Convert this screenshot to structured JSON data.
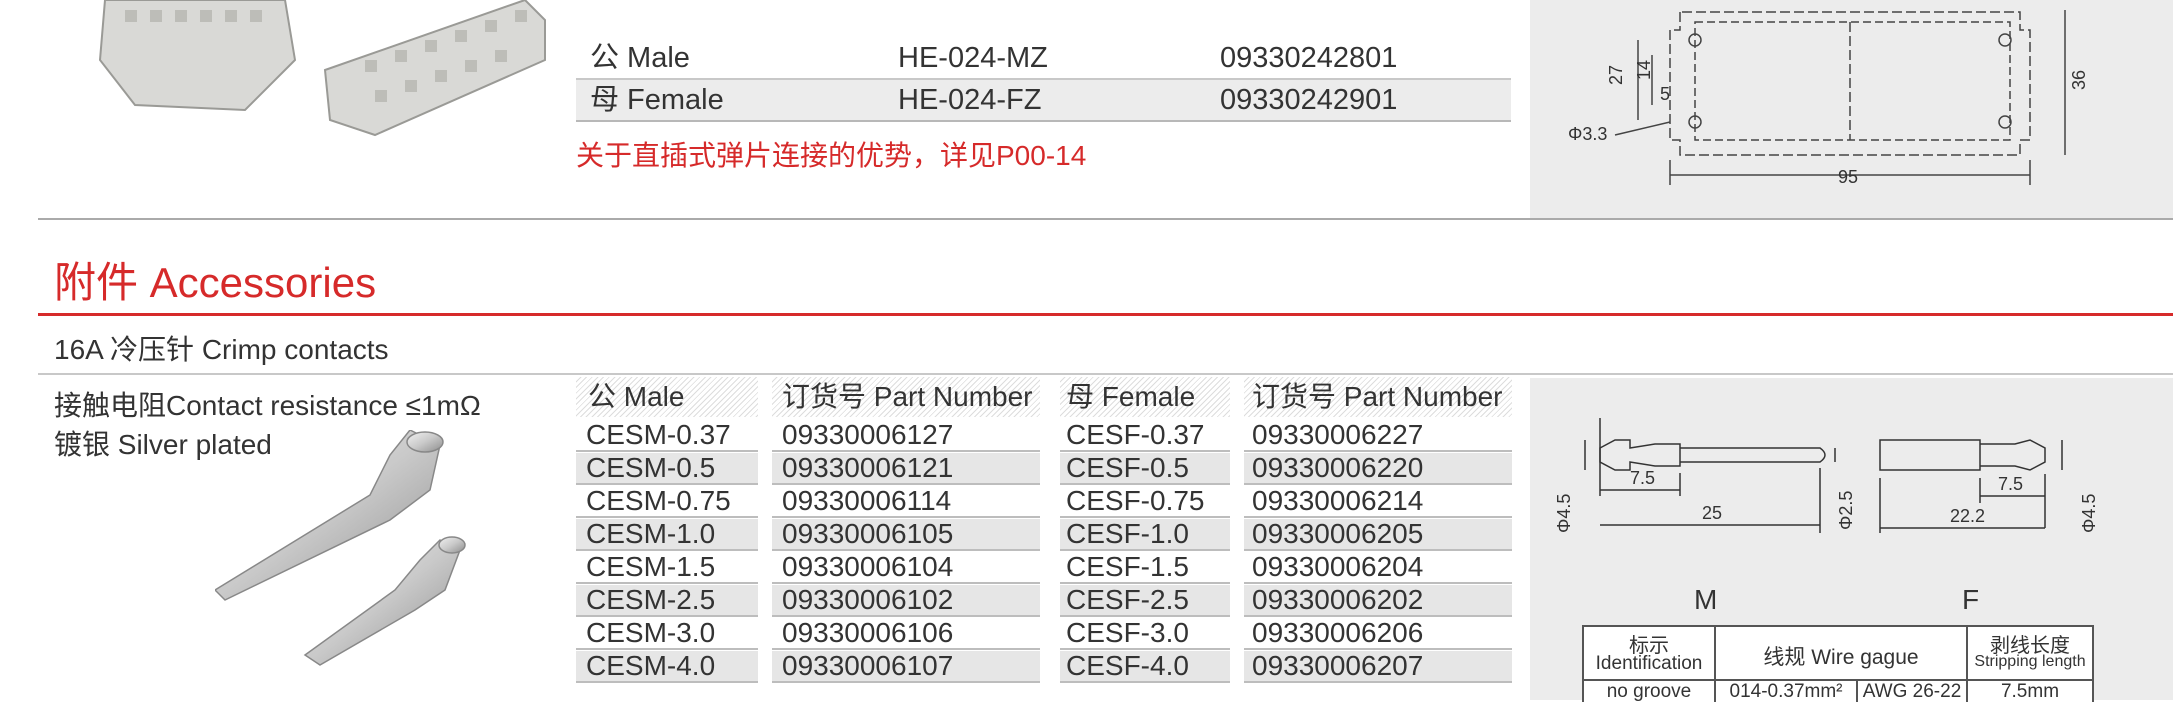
{
  "top_table": {
    "rows": [
      {
        "type": "公 Male",
        "model": "HE-024-MZ",
        "part": "09330242801"
      },
      {
        "type": "母 Female",
        "model": "HE-024-FZ",
        "part": "09330242901"
      }
    ],
    "note": "关于直插式弹片连接的优势，详见P00-14"
  },
  "drawing_top": {
    "d27": "27",
    "d14": "14",
    "d5": "5",
    "d36": "36",
    "phi": "Φ3.3",
    "d95": "95"
  },
  "section": {
    "title": "附件 Accessories"
  },
  "subsection": {
    "title": "16A 冷压针 Crimp contacts"
  },
  "specs": {
    "resistance": "接触电阻Contact resistance ≤1mΩ",
    "plating": "镀银 Silver plated"
  },
  "parts_table": {
    "headers": [
      "公 Male",
      "订货号 Part Number",
      "母 Female",
      "订货号 Part Number"
    ],
    "rows": [
      {
        "male": "CESM-0.37",
        "male_pn": "09330006127",
        "female": "CESF-0.37",
        "female_pn": "09330006227"
      },
      {
        "male": "CESM-0.5",
        "male_pn": "09330006121",
        "female": "CESF-0.5",
        "female_pn": "09330006220"
      },
      {
        "male": "CESM-0.75",
        "male_pn": "09330006114",
        "female": "CESF-0.75",
        "female_pn": "09330006214"
      },
      {
        "male": "CESM-1.0",
        "male_pn": "09330006105",
        "female": "CESF-1.0",
        "female_pn": "09330006205"
      },
      {
        "male": "CESM-1.5",
        "male_pn": "09330006104",
        "female": "CESF-1.5",
        "female_pn": "09330006204"
      },
      {
        "male": "CESM-2.5",
        "male_pn": "09330006102",
        "female": "CESF-2.5",
        "female_pn": "09330006202"
      },
      {
        "male": "CESM-3.0",
        "male_pn": "09330006106",
        "female": "CESF-3.0",
        "female_pn": "09330006206"
      },
      {
        "male": "CESM-4.0",
        "male_pn": "09330006107",
        "female": "CESF-4.0",
        "female_pn": "09330006207"
      }
    ]
  },
  "drawing_pins": {
    "m_phi": "Φ4.5",
    "m_75": "7.5",
    "m_25": "25",
    "m_phi25": "Φ2.5",
    "f_75": "7.5",
    "f_222": "22.2",
    "f_phi": "Φ4.5",
    "label_m": "M",
    "label_f": "F"
  },
  "wire_table": {
    "h1_cn": "标示",
    "h1_en": "Identification",
    "h2": "线规 Wire gague",
    "h3_cn": "剥线长度",
    "h3_en": "Stripping length",
    "r1_id": "no groove",
    "r1_mm": "014-0.37mm²",
    "r1_awg": "AWG 26-22",
    "r1_len": "7.5mm"
  },
  "colors": {
    "accent_red": "#d62a2a",
    "panel_gray": "#ececec"
  }
}
